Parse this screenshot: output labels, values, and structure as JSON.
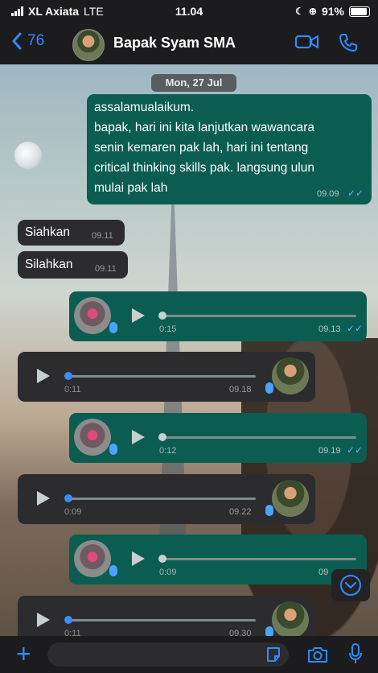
{
  "status_bar": {
    "carrier": "XL Axiata",
    "network": "LTE",
    "time": "11.04",
    "battery": "91%"
  },
  "header": {
    "back_count": "76",
    "contact_name": "Bapak Syam SMA"
  },
  "date_separator": "Mon, 27 Jul",
  "messages": [
    {
      "type": "text",
      "direction": "out",
      "lines": [
        "assalamualaikum.",
        "bapak, hari ini kita lanjutkan wawancara",
        "senin kemaren pak lah, hari ini tentang",
        "critical thinking skills pak. langsung ulun",
        "mulai pak lah"
      ],
      "time": "09.09"
    },
    {
      "type": "text",
      "direction": "in",
      "text": "Siahkan",
      "time": "09.11"
    },
    {
      "type": "text",
      "direction": "in",
      "text": "Silahkan",
      "time": "09.11"
    },
    {
      "type": "voice",
      "direction": "out",
      "duration": "0:15",
      "time": "09.13"
    },
    {
      "type": "voice",
      "direction": "in",
      "duration": "0:11",
      "time": "09.18"
    },
    {
      "type": "voice",
      "direction": "out",
      "duration": "0:12",
      "time": "09.19"
    },
    {
      "type": "voice",
      "direction": "in",
      "duration": "0:09",
      "time": "09.22"
    },
    {
      "type": "voice",
      "direction": "out",
      "duration": "0:09",
      "time": "09"
    },
    {
      "type": "voice",
      "direction": "in",
      "duration": "0:11",
      "time": "09.30"
    }
  ],
  "icons": {
    "back": "chevron-left-icon",
    "video": "video-camera-icon",
    "call": "phone-icon",
    "scroll_down": "chevron-down-circle-icon",
    "plus": "plus-icon",
    "sticker": "sticker-icon",
    "camera": "camera-icon",
    "mic": "microphone-icon"
  },
  "colors": {
    "accent": "#2f8cff",
    "outgoing_bubble": "#0b5d52",
    "incoming_bubble": "#2c2c2e",
    "read_ticks": "#5ab0ff"
  }
}
